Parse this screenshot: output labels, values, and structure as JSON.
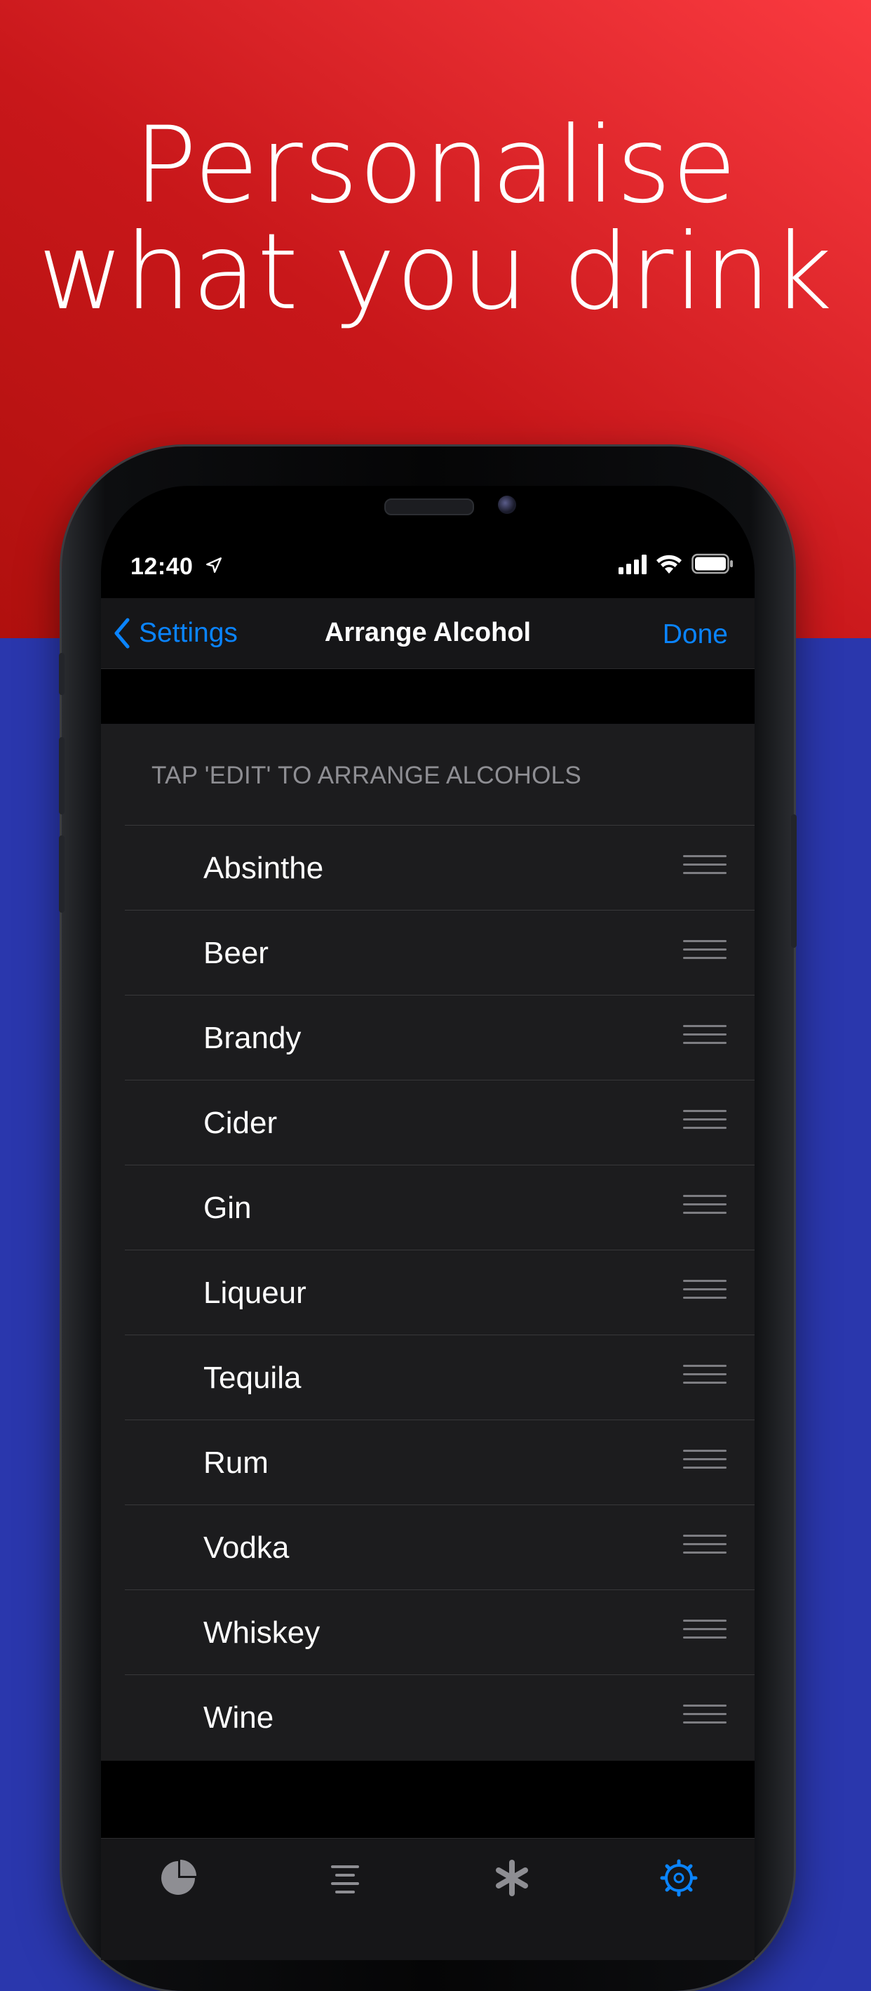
{
  "headline": {
    "line1": "Personalise",
    "line2": "what you drink"
  },
  "status_bar": {
    "time": "12:40"
  },
  "navbar": {
    "back_label": "Settings",
    "title": "Arrange Alcohol",
    "done_label": "Done"
  },
  "list": {
    "section_header": "TAP 'EDIT' TO ARRANGE ALCOHOLS",
    "items": [
      {
        "label": "Absinthe"
      },
      {
        "label": "Beer"
      },
      {
        "label": "Brandy"
      },
      {
        "label": "Cider"
      },
      {
        "label": "Gin"
      },
      {
        "label": "Liqueur"
      },
      {
        "label": "Tequila"
      },
      {
        "label": "Rum"
      },
      {
        "label": "Vodka"
      },
      {
        "label": "Whiskey"
      },
      {
        "label": "Wine"
      }
    ]
  },
  "tabbar": {
    "tabs": [
      {
        "icon": "pie-chart-icon"
      },
      {
        "icon": "list-icon"
      },
      {
        "icon": "asterisk-icon"
      },
      {
        "icon": "settings-gear-icon",
        "selected": true
      }
    ]
  },
  "colors": {
    "accent": "#0a84ff",
    "top_background": "#c8171a",
    "bottom_background": "#2a37ad"
  }
}
